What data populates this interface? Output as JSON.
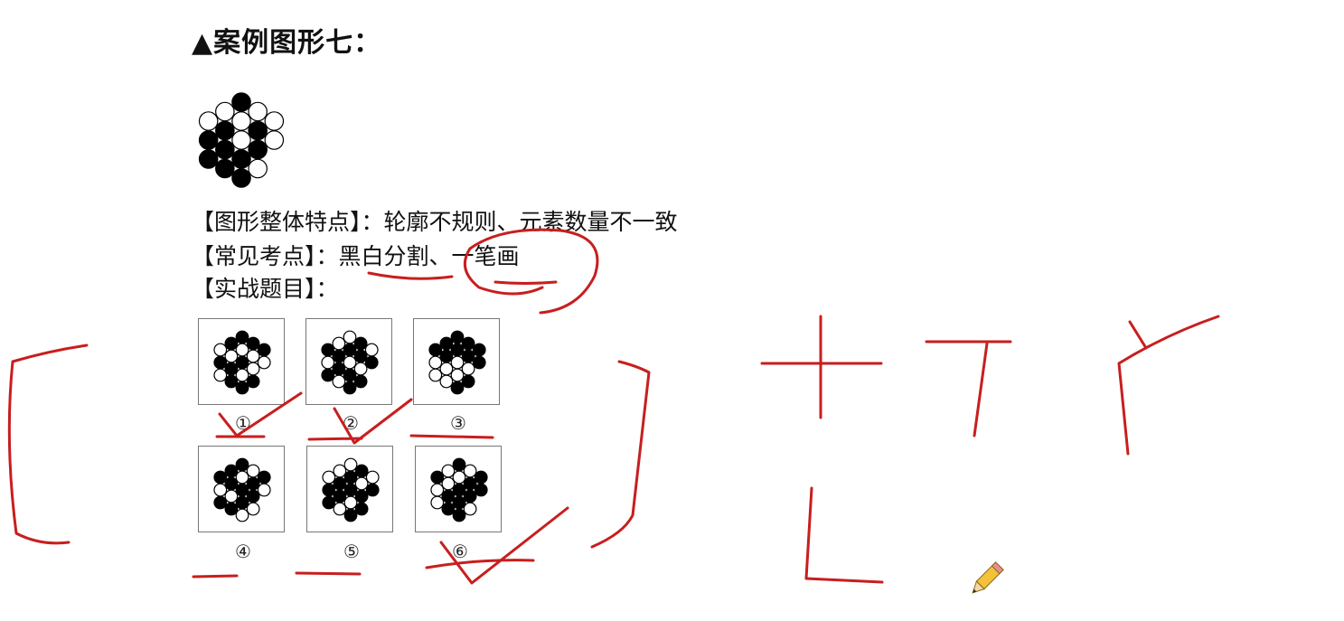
{
  "title": "▲案例图形七：",
  "lines": {
    "features": "【图形整体特点】：轮廓不规则、元素数量不一致",
    "points": "【常见考点】：黑白分割、一笔画",
    "practice": "【实战题目】："
  },
  "options": [
    {
      "label": "①",
      "pattern": [
        1,
        0,
        1,
        0,
        1,
        1,
        0,
        1,
        1,
        1,
        0,
        0,
        1,
        0,
        1,
        0,
        1,
        0
      ]
    },
    {
      "label": "②",
      "pattern": [
        0,
        1,
        0,
        1,
        1,
        0,
        1,
        1,
        0,
        1,
        1,
        0,
        1,
        1,
        0,
        1,
        0,
        1
      ]
    },
    {
      "label": "③",
      "pattern": [
        1,
        1,
        0,
        0,
        1,
        1,
        1,
        0,
        0,
        1,
        1,
        0,
        1,
        1,
        0,
        0,
        1,
        1
      ]
    },
    {
      "label": "④",
      "pattern": [
        1,
        0,
        1,
        1,
        0,
        1,
        1,
        0,
        1,
        0,
        1,
        1,
        0,
        1,
        0,
        1,
        1,
        0
      ]
    },
    {
      "label": "⑤",
      "pattern": [
        0,
        1,
        1,
        0,
        1,
        0,
        1,
        1,
        0,
        1,
        0,
        1,
        1,
        0,
        1,
        1,
        0,
        1
      ]
    },
    {
      "label": "⑥",
      "pattern": [
        1,
        0,
        1,
        1,
        1,
        0,
        0,
        1,
        1,
        0,
        1,
        1,
        0,
        1,
        0,
        0,
        1,
        1
      ]
    }
  ],
  "main_pattern": [
    1,
    0,
    0,
    1,
    1,
    0,
    1,
    1,
    1,
    0,
    1,
    1,
    0,
    0,
    1,
    1,
    0,
    0
  ],
  "colors": {
    "ink": "#c81e1e",
    "disc_black": "#000000",
    "disc_white": "#ffffff"
  }
}
